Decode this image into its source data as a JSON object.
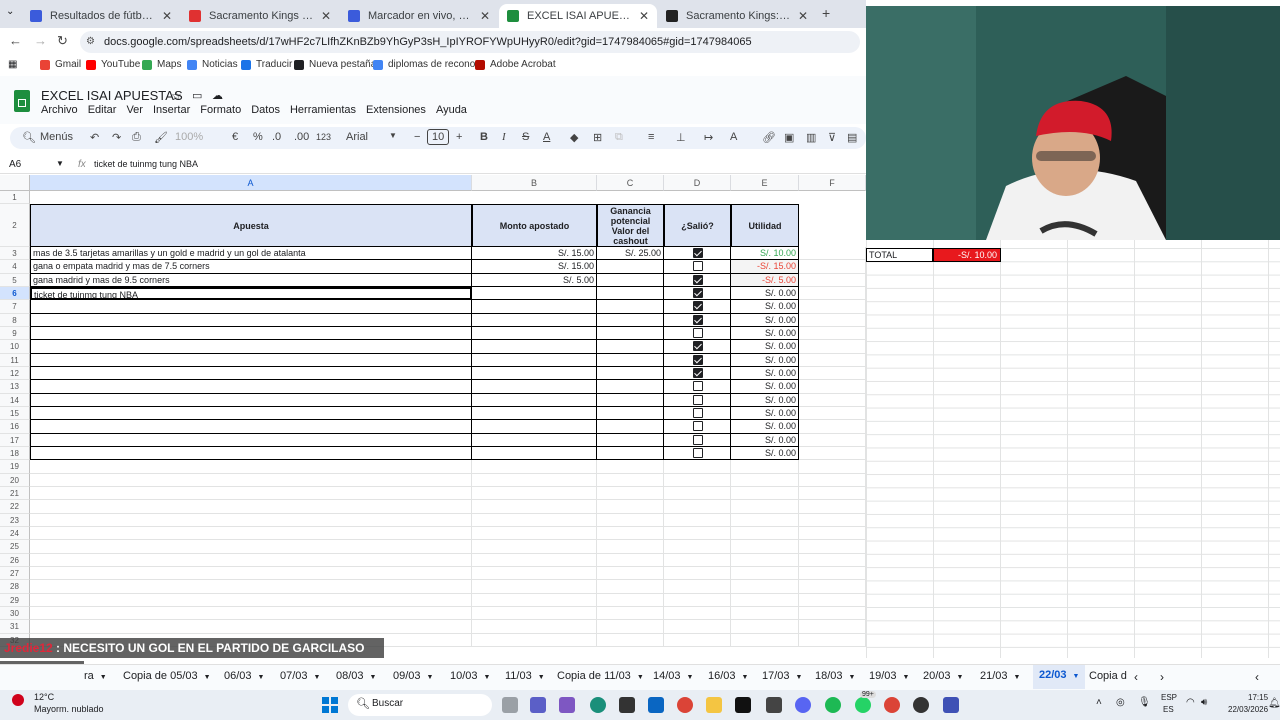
{
  "browser": {
    "tabs": [
      {
        "label": "Resultados de fútbol en directo",
        "color": "#3b5bdb"
      },
      {
        "label": "Sacramento Kings - Brooklyn N...",
        "color": "#e03131"
      },
      {
        "label": "Marcador en vivo, calendario y...",
        "color": "#3b5bdb"
      },
      {
        "label": "EXCEL ISAI APUESTAS - Hojas d...",
        "color": "#1e8e3e"
      },
      {
        "label": "Sacramento Kings: marcadores...",
        "color": "#222222"
      }
    ],
    "url": "docs.google.com/spreadsheets/d/17wHF2c7LIfhZKnBZb9YhGyP3sH_IpIYROFYWpUHyyR0/edit?gid=1747984065#gid=1747984065",
    "bookmarks": [
      "Gmail",
      "YouTube",
      "Maps",
      "Noticias",
      "Traducir",
      "Nueva pestaña",
      "diplomas de recono...",
      "Adobe Acrobat"
    ]
  },
  "doc": {
    "title": "EXCEL ISAI APUESTAS",
    "menu": [
      "Archivo",
      "Editar",
      "Ver",
      "Insertar",
      "Formato",
      "Datos",
      "Herramientas",
      "Extensiones",
      "Ayuda"
    ]
  },
  "toolbar": {
    "search": "Menús",
    "zoom": "100%",
    "currency": "€",
    "percent": "%",
    "dec_less": ".0",
    "dec_more": ".00",
    "num_fmt": "123",
    "font": "Arial",
    "font_size": "10"
  },
  "formula": {
    "cell_ref": "A6",
    "fx": "fx",
    "content": "ticket de tuinmg tung NBA"
  },
  "columns": [
    "A",
    "B",
    "C",
    "D",
    "E",
    "F"
  ],
  "header_row": {
    "a": "Apuesta",
    "b": "Monto apostado",
    "c": "Ganancia potencial Valor del cashout",
    "d": "¿Salió?",
    "e": "Utilidad"
  },
  "rows": [
    {
      "n": "3",
      "a": "mas de 3.5 tarjetas amarillas y un gold e madrid y un gol de atalanta",
      "b": "S/. 15.00",
      "c": "S/. 25.00",
      "d": true,
      "e": "S/. 10.00",
      "ecolor": "#34a853",
      "ebg": ""
    },
    {
      "n": "4",
      "a": "gana o empata madrid y mas de 7.5 corners",
      "b": "S/. 15.00",
      "c": "",
      "d": false,
      "e": "-S/. 15.00",
      "ecolor": "#ea4335",
      "ebg": "#f4f4f4"
    },
    {
      "n": "5",
      "a": "gana madrid y mas de 9.5 corners",
      "b": "S/. 5.00",
      "c": "",
      "d": true,
      "e": "-S/. 5.00",
      "ecolor": "#ea4335",
      "ebg": "#f4f4f4"
    },
    {
      "n": "6",
      "a": "ticket de tuinmg tung NBA",
      "b": "",
      "c": "",
      "d": true,
      "e": "S/. 0.00",
      "ecolor": "#202124",
      "ebg": ""
    },
    {
      "n": "7",
      "a": "",
      "b": "",
      "c": "",
      "d": true,
      "e": "S/. 0.00",
      "ecolor": "#202124",
      "ebg": ""
    },
    {
      "n": "8",
      "a": "",
      "b": "",
      "c": "",
      "d": true,
      "e": "S/. 0.00",
      "ecolor": "#202124",
      "ebg": ""
    },
    {
      "n": "9",
      "a": "",
      "b": "",
      "c": "",
      "d": false,
      "e": "S/. 0.00",
      "ecolor": "#202124",
      "ebg": ""
    },
    {
      "n": "10",
      "a": "",
      "b": "",
      "c": "",
      "d": true,
      "e": "S/. 0.00",
      "ecolor": "#202124",
      "ebg": ""
    },
    {
      "n": "11",
      "a": "",
      "b": "",
      "c": "",
      "d": true,
      "e": "S/. 0.00",
      "ecolor": "#202124",
      "ebg": ""
    },
    {
      "n": "12",
      "a": "",
      "b": "",
      "c": "",
      "d": true,
      "e": "S/. 0.00",
      "ecolor": "#202124",
      "ebg": ""
    },
    {
      "n": "13",
      "a": "",
      "b": "",
      "c": "",
      "d": false,
      "e": "S/. 0.00",
      "ecolor": "#202124",
      "ebg": ""
    },
    {
      "n": "14",
      "a": "",
      "b": "",
      "c": "",
      "d": false,
      "e": "S/. 0.00",
      "ecolor": "#202124",
      "ebg": ""
    },
    {
      "n": "15",
      "a": "",
      "b": "",
      "c": "",
      "d": false,
      "e": "S/. 0.00",
      "ecolor": "#202124",
      "ebg": ""
    },
    {
      "n": "16",
      "a": "",
      "b": "",
      "c": "",
      "d": false,
      "e": "S/. 0.00",
      "ecolor": "#202124",
      "ebg": ""
    },
    {
      "n": "17",
      "a": "",
      "b": "",
      "c": "",
      "d": false,
      "e": "S/. 0.00",
      "ecolor": "#202124",
      "ebg": ""
    },
    {
      "n": "18",
      "a": "",
      "b": "",
      "c": "",
      "d": false,
      "e": "S/. 0.00",
      "ecolor": "#202124",
      "ebg": ""
    }
  ],
  "empty_rows": [
    "1",
    "19",
    "20",
    "21",
    "22",
    "23",
    "24",
    "25",
    "26",
    "27",
    "28",
    "29",
    "30",
    "31",
    "32"
  ],
  "total": {
    "label": "TOTAL",
    "value": "-S/. 10.00",
    "bg": "#e8191d"
  },
  "sheet_tabs": [
    "ra",
    "Copia de 05/03",
    "06/03",
    "07/03",
    "08/03",
    "09/03",
    "10/03",
    "11/03",
    "Copia de 11/03",
    "14/03",
    "16/03",
    "17/03",
    "18/03",
    "19/03",
    "20/03",
    "21/03",
    "22/03",
    "Copia d"
  ],
  "active_sheet": "22/03",
  "chat": [
    {
      "user": "Jredie12",
      "msg": "NECESITO UN GOL EN EL PARTIDO DE GARCILASO"
    },
    {
      "user": "Jredie12",
      "msg": "🍔"
    }
  ],
  "taskbar": {
    "weather_temp": "12°C",
    "weather_desc": "Mayorm. nublado",
    "search": "Buscar",
    "lang1": "ESP",
    "lang2": "ES",
    "time": "17:15",
    "date": "22/03/2026",
    "badge": "99+"
  }
}
